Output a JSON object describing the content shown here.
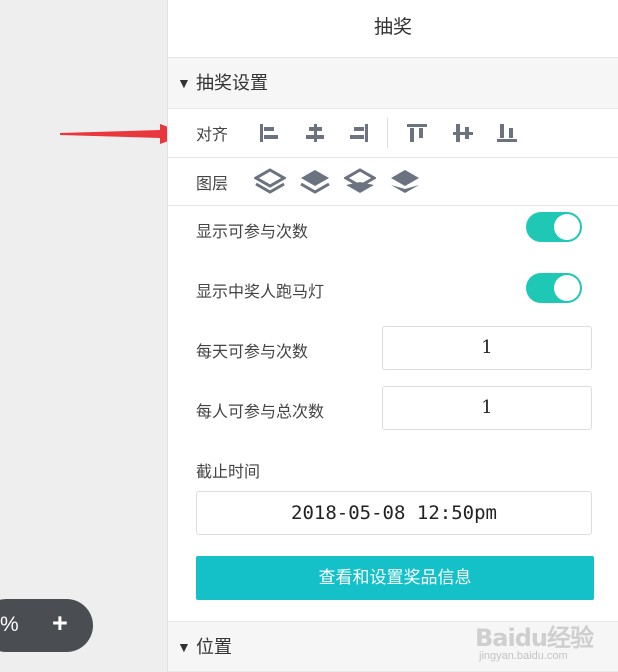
{
  "canvas": {
    "zoom_percent": "%",
    "zoom_in_label": "+"
  },
  "panel": {
    "title": "抽奖",
    "section_lottery": "抽奖设置",
    "section_position": "位置",
    "section_toggle_glyph": "▼"
  },
  "align": {
    "label": "对齐",
    "icons": [
      "align-left-icon",
      "align-center-h-icon",
      "align-right-icon",
      "align-top-icon",
      "align-middle-v-icon",
      "align-bottom-icon"
    ]
  },
  "layer": {
    "label": "图层",
    "icons": [
      "layer-top-icon",
      "layer-up-icon",
      "layer-down-icon",
      "layer-bottom-icon"
    ]
  },
  "settings": {
    "show_participation_count": {
      "label": "显示可参与次数",
      "enabled": true
    },
    "show_winner_marquee": {
      "label": "显示中奖人跑马灯",
      "enabled": true
    },
    "daily_attempts": {
      "label": "每天可参与次数",
      "value": "1"
    },
    "total_attempts": {
      "label": "每人可参与总次数",
      "value": "1"
    },
    "deadline": {
      "label": "截止时间",
      "value": "2018-05-08 12:50pm"
    },
    "prize_button": "查看和设置奖品信息"
  },
  "watermark": {
    "logo": "Baidu经验",
    "sub": "jingyan.baidu.com"
  },
  "colors": {
    "accent": "#1fc8b4",
    "button": "#14c1c8",
    "arrow": "#e8383d",
    "icon": "#6b7280"
  }
}
